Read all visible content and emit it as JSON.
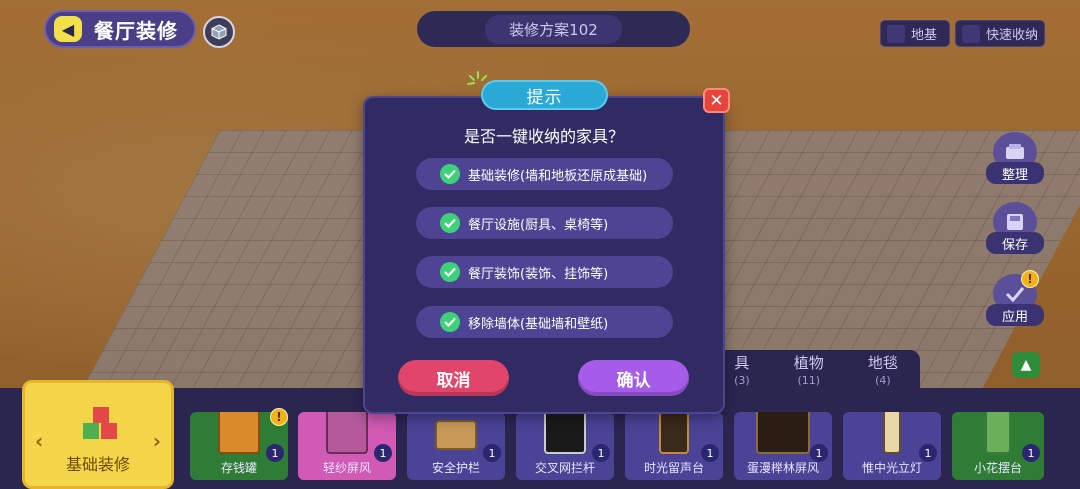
{
  "header": {
    "title": "餐厅装修",
    "plan_name": "装修方案102",
    "foundation_label": "地基",
    "quick_store_label": "快速收纳"
  },
  "side": {
    "organize_label": "整理",
    "save_label": "保存",
    "apply_label": "应用",
    "apply_badge": "!"
  },
  "dialog": {
    "title": "提示",
    "question": "是否一键收纳的家具？",
    "options": [
      "基础装修(墙和地板还原成基础)",
      "餐厅设施(厨具、桌椅等)",
      "餐厅装饰(装饰、挂饰等)",
      "移除墙体(基础墙和壁纸)"
    ],
    "cancel_label": "取消",
    "confirm_label": "确认",
    "close_symbol": "✕"
  },
  "categories": {
    "current": "基础装修",
    "tabs": [
      {
        "label": "具",
        "count": "(3)"
      },
      {
        "label": "植物",
        "count": "(11)"
      },
      {
        "label": "地毯",
        "count": "(4)"
      }
    ]
  },
  "items": [
    {
      "name": "存钱罐",
      "count": "1",
      "badge": "!"
    },
    {
      "name": "轻纱屏风",
      "count": "1"
    },
    {
      "name": "安全护栏",
      "count": "1"
    },
    {
      "name": "交叉网拦杆",
      "count": "1"
    },
    {
      "name": "时光留声台",
      "count": "1"
    },
    {
      "name": "蛋漫榉林屏风",
      "count": "1"
    },
    {
      "name": "惟中光立灯",
      "count": "1"
    },
    {
      "name": "小花摆台",
      "count": "1"
    }
  ],
  "colors": {
    "dialog_bg": "#302b63",
    "option_bg": "#4d4593",
    "check": "#3fd07a",
    "cancel": "#e2456a",
    "confirm": "#a55ce8",
    "title_pill": "#2ba9d6"
  },
  "icons": {
    "back": "back-arrow-icon",
    "cube": "cube-icon",
    "close": "close-icon",
    "check": "check-icon",
    "up": "chevron-up-icon"
  }
}
